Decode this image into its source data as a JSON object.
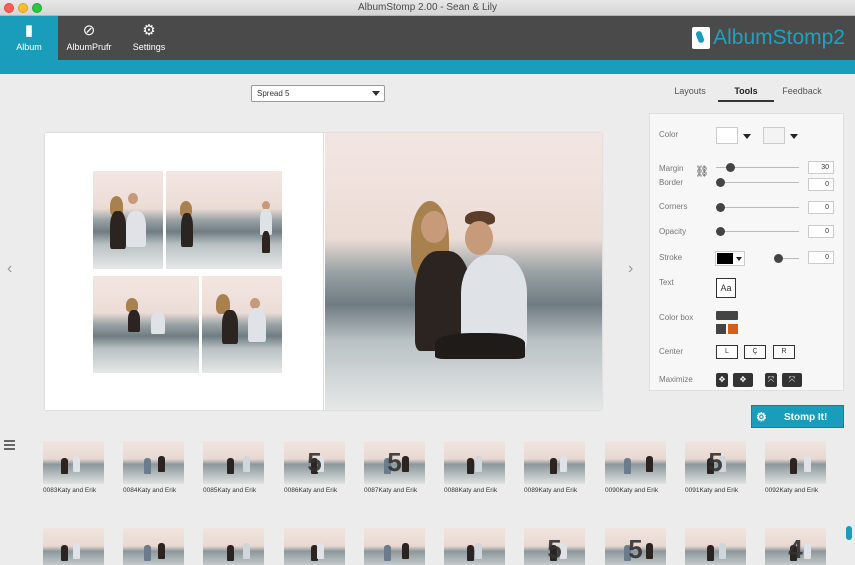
{
  "window": {
    "title": "AlbumStomp 2.00 - Sean & Lily"
  },
  "toolbar": {
    "buttons": [
      {
        "label": "Album",
        "icon": "album-icon"
      },
      {
        "label": "AlbumPrufr",
        "icon": "proofer-icon"
      },
      {
        "label": "Settings",
        "icon": "gear-icon"
      }
    ],
    "active": "Album"
  },
  "logo": {
    "text": "AlbumStomp2"
  },
  "spread_selector": {
    "value": "Spread 5"
  },
  "panel_tabs": [
    "Layouts",
    "Tools",
    "Feedback"
  ],
  "active_tab": "Tools",
  "tools": {
    "color_label": "Color",
    "margin_label": "Margin",
    "margin_value": "30",
    "border_label": "Border",
    "border_value": "0",
    "corners_label": "Corners",
    "corners_value": "0",
    "opacity_label": "Opacity",
    "opacity_value": "0",
    "stroke_label": "Stroke",
    "stroke_value": "0",
    "text_label": "Text",
    "text_button": "Aa",
    "colorbox_label": "Color box",
    "center_label": "Center",
    "center_buttons": [
      "L",
      "Ç",
      "R"
    ],
    "maximize_label": "Maximize"
  },
  "stomp_button": {
    "label": "Stomp It!"
  },
  "thumbnails_row1": [
    {
      "caption": "0083Katy and Erik",
      "badge": ""
    },
    {
      "caption": "0084Katy and Erik",
      "badge": ""
    },
    {
      "caption": "0085Katy and Erik",
      "badge": ""
    },
    {
      "caption": "0086Katy and Erik",
      "badge": "5"
    },
    {
      "caption": "0087Katy and Erik",
      "badge": "5"
    },
    {
      "caption": "0088Katy and Erik",
      "badge": ""
    },
    {
      "caption": "0089Katy and Erik",
      "badge": ""
    },
    {
      "caption": "0090Katy and Erik",
      "badge": ""
    },
    {
      "caption": "0091Katy and Erik",
      "badge": "5"
    },
    {
      "caption": "0092Katy and Erik",
      "badge": ""
    }
  ],
  "thumbnails_row2": [
    {
      "badge": ""
    },
    {
      "badge": ""
    },
    {
      "badge": ""
    },
    {
      "badge": ""
    },
    {
      "badge": ""
    },
    {
      "badge": ""
    },
    {
      "badge": "5"
    },
    {
      "badge": "5"
    },
    {
      "badge": ""
    },
    {
      "badge": "4"
    }
  ]
}
